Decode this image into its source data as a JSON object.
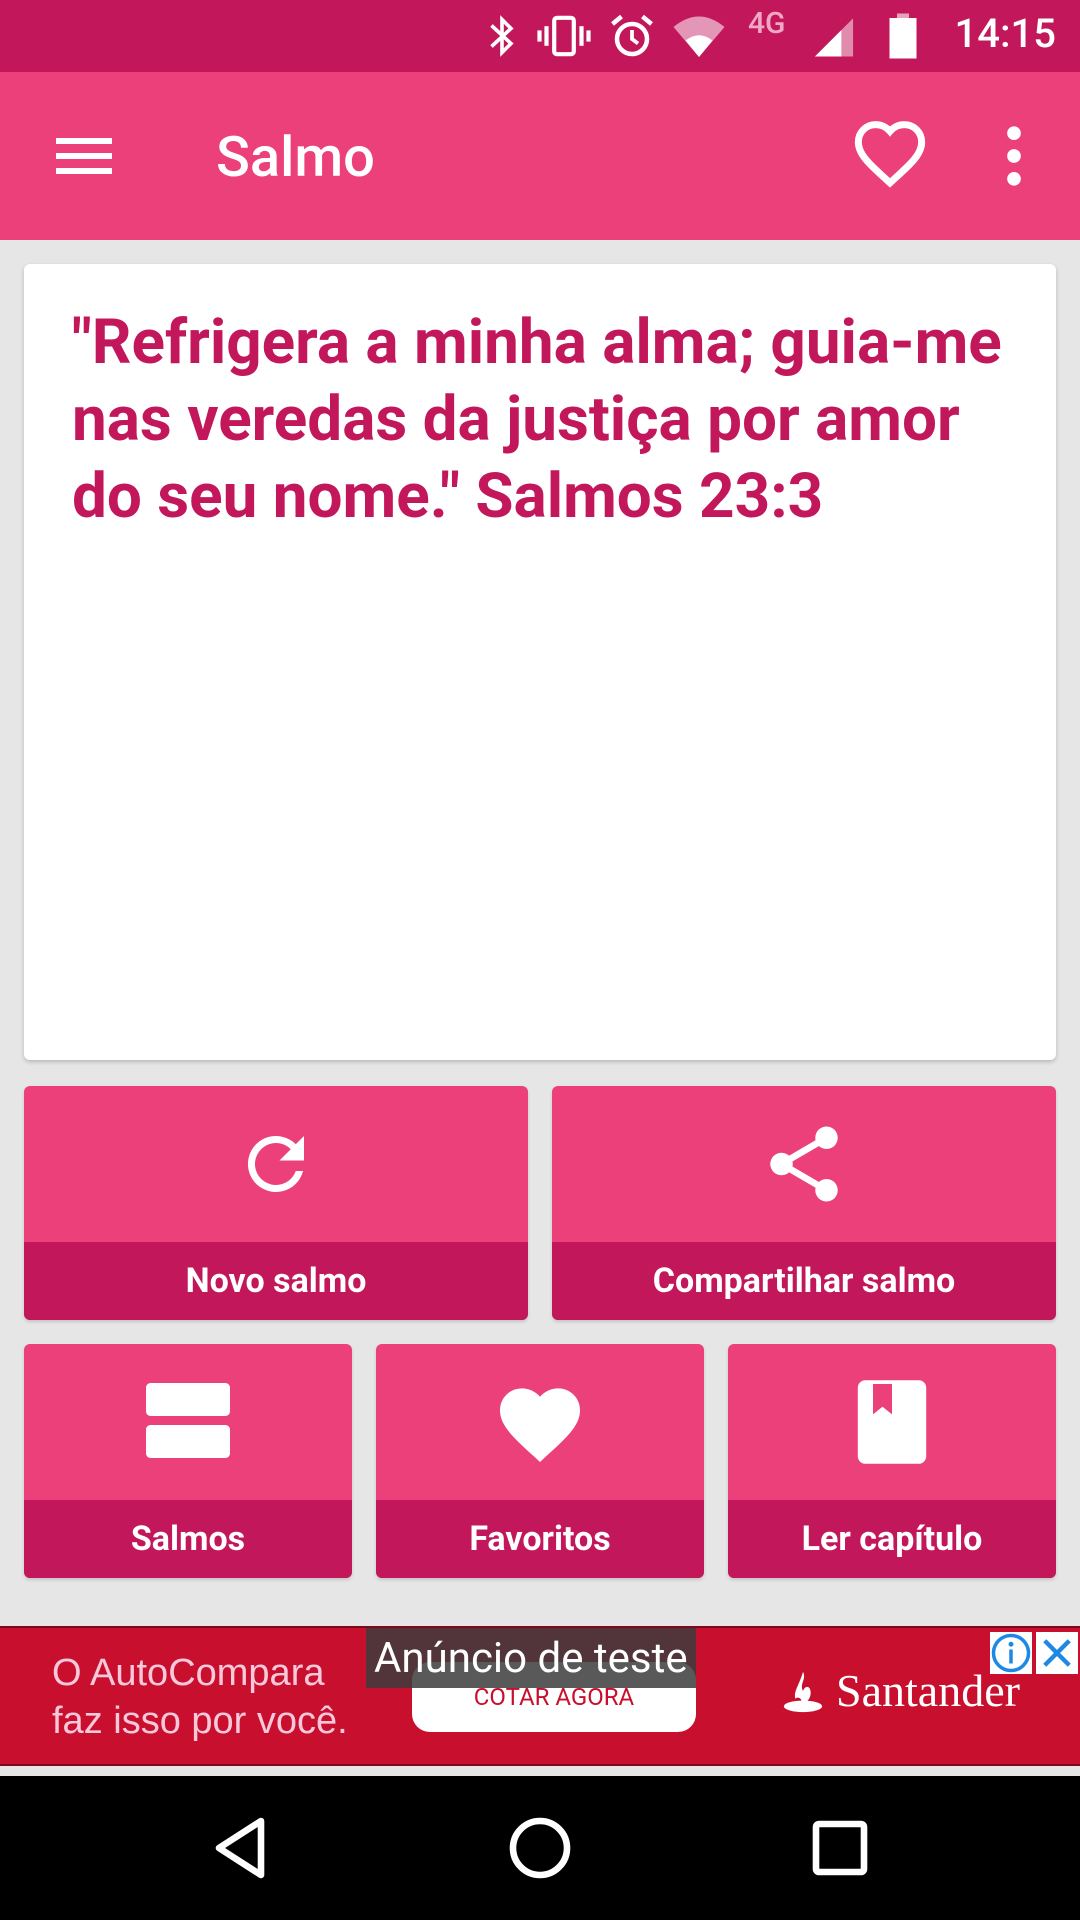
{
  "status_bar": {
    "time": "14:15",
    "network": "4G",
    "icons": [
      "bluetooth-icon",
      "vibrate-icon",
      "alarm-icon",
      "wifi-icon",
      "signal-icon",
      "battery-icon"
    ]
  },
  "app_bar": {
    "title": "Salmo",
    "icons": [
      "menu-icon",
      "heart-outline-icon",
      "more-vert-icon"
    ]
  },
  "verse": {
    "text": "\"Refrigera a minha alma; guia-me nas veredas da justiça por amor do seu nome.\" Salmos 23:3"
  },
  "actions": {
    "new_psalm": "Novo salmo",
    "share_psalm": "Compartilhar salmo",
    "psalms": "Salmos",
    "favorites": "Favoritos",
    "read_chapter": "Ler capítulo"
  },
  "ad": {
    "tag": "Anúncio de teste",
    "line1": "O AutoCompara",
    "line2": "faz isso por você.",
    "cta": "COTAR AGORA",
    "brand": "Santander"
  },
  "colors": {
    "primary": "#ec407a",
    "primary_dark": "#c2185b",
    "background": "#e6e6e6",
    "ad_red": "#c8102e"
  }
}
